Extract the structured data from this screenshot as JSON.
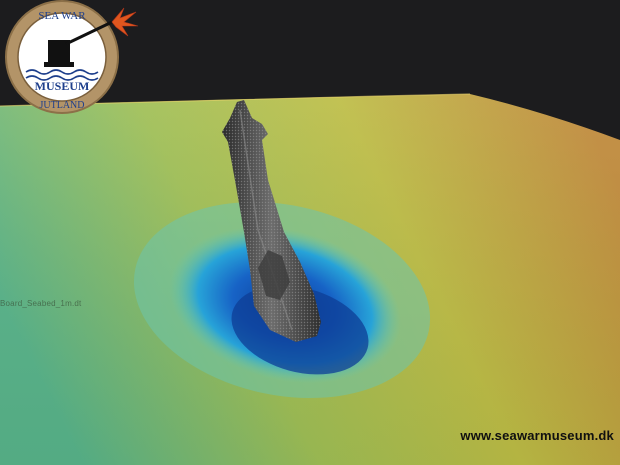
{
  "scene": {
    "layer_label": "Board_Seabed_1m.dt",
    "colors": {
      "background": "#1c1c1e",
      "seabed_low": "#58b48a",
      "seabed_mid": "#b8c24a",
      "seabed_high": "#c08a3a",
      "scour_hole": "#1a6fd0",
      "wreck": "#4a4a4a"
    }
  },
  "logo": {
    "top_text": "SEA WAR",
    "middle_text": "MUSEUM",
    "bottom_text": "JUTLAND",
    "colors": {
      "ring": "#b39468",
      "ink": "#1e3f8c",
      "flash": "#e0561e"
    },
    "icons": [
      "cannon-icon",
      "muzzle-flash-icon",
      "waves-icon"
    ]
  },
  "footer": {
    "website": "www.seawarmuseum.dk"
  }
}
